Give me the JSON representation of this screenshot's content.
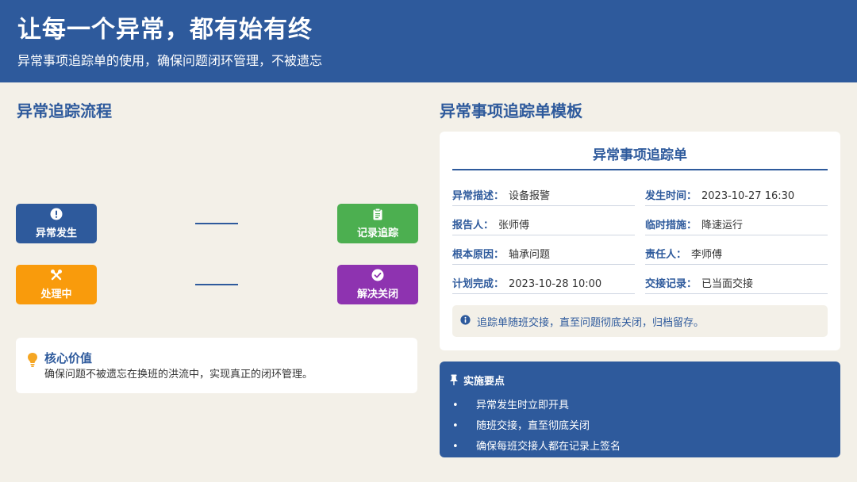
{
  "header": {
    "title": "让每一个异常，都有始有终",
    "subtitle": "异常事项追踪单的使用，确保问题闭环管理，不被遗忘"
  },
  "left": {
    "section_title": "异常追踪流程",
    "flow": [
      {
        "label": "异常发生",
        "icon": "exclamation-circle-icon",
        "color": "#2e5a9c"
      },
      {
        "label": "记录追踪",
        "icon": "clipboard-icon",
        "color": "#4caf50"
      },
      {
        "label": "处理中",
        "icon": "tools-icon",
        "color": "#f99b0c"
      },
      {
        "label": "解决关闭",
        "icon": "check-circle-icon",
        "color": "#8e33b0"
      }
    ],
    "value_card": {
      "icon": "lightbulb-icon",
      "title": "核心价值",
      "text": "确保问题不被遗忘在换班的洪流中，实现真正的闭环管理。"
    }
  },
  "right": {
    "section_title": "异常事项追踪单模板",
    "form": {
      "title": "异常事项追踪单",
      "fields": [
        {
          "label": "异常描述：",
          "value": "设备报警"
        },
        {
          "label": "发生时间：",
          "value": "2023-10-27 16:30"
        },
        {
          "label": "报告人：",
          "value": "张师傅"
        },
        {
          "label": "临时措施：",
          "value": "降速运行"
        },
        {
          "label": "根本原因：",
          "value": "轴承问题"
        },
        {
          "label": "责任人：",
          "value": "李师傅"
        },
        {
          "label": "计划完成：",
          "value": "2023-10-28 10:00"
        },
        {
          "label": "交接记录：",
          "value": "已当面交接"
        }
      ],
      "note": {
        "icon": "info-circle-icon",
        "text": "追踪单随班交接，直至问题彻底关闭，归档留存。"
      }
    },
    "points": {
      "icon": "pin-icon",
      "title": "实施要点",
      "items": [
        "异常发生时立即开具",
        "随班交接，直至彻底关闭",
        "确保每班交接人都在记录上签名"
      ]
    }
  },
  "colors": {
    "primary": "#2e5a9c",
    "background": "#f3f0e8",
    "green": "#4caf50",
    "orange": "#f99b0c",
    "purple": "#8e33b0"
  }
}
